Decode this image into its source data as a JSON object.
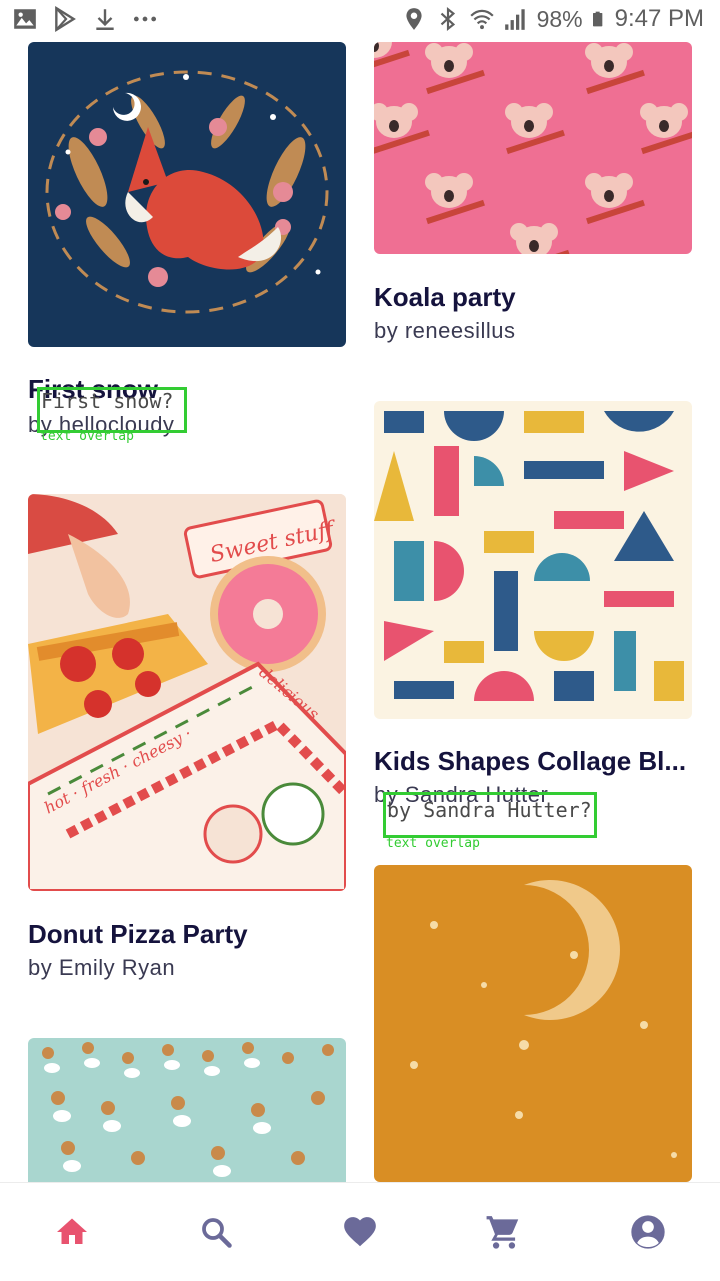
{
  "status": {
    "battery": "98%",
    "time": "9:47 PM"
  },
  "cards": [
    {
      "title": "First snow",
      "author": "by hellocloudy"
    },
    {
      "title": "Koala party",
      "author": "by reneesillus"
    },
    {
      "title": "Donut Pizza Party",
      "author": "by Emily Ryan"
    },
    {
      "title": "Kids Shapes Collage Bl...",
      "author": "by Sandra Hutter"
    },
    {
      "title": "",
      "author": ""
    }
  ],
  "art_labels": {
    "sweet": "Sweet stuff",
    "box_a": "hot · fresh · cheesy · ",
    "box_b": "delicious"
  },
  "annotations": [
    {
      "guess": "First snow?",
      "tag": "text overlap"
    },
    {
      "guess": "by Sandra Hutter?",
      "tag": "text overlap"
    }
  ],
  "nav": {
    "items": [
      "home-icon",
      "search-icon",
      "heart-icon",
      "cart-icon",
      "account-icon"
    ],
    "active_color": "#e8536f",
    "inactive_color": "#6b6a99"
  }
}
